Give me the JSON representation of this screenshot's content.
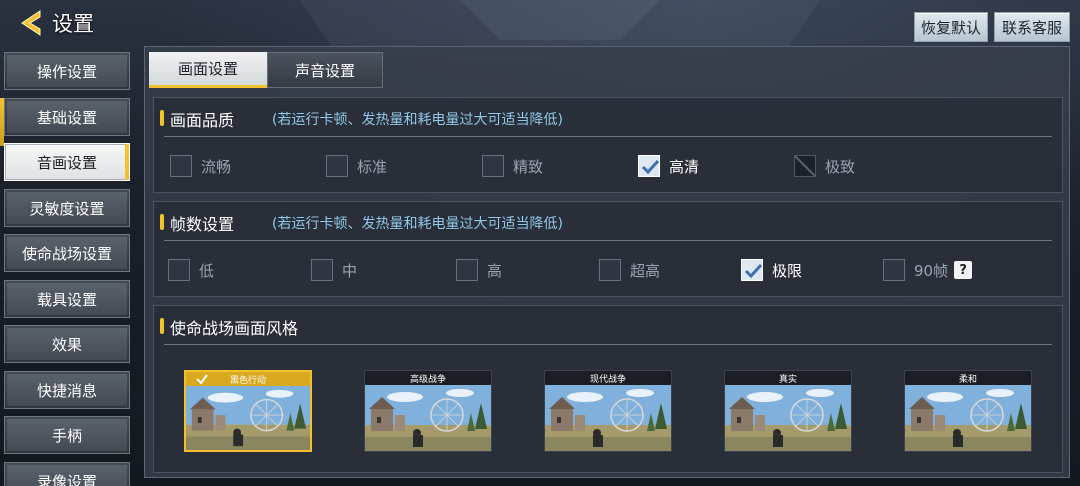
{
  "header": {
    "title": "设置",
    "buttons": {
      "reset": "恢复默认",
      "support": "联系客服"
    }
  },
  "sidebar": {
    "items": [
      {
        "label": "操作设置",
        "active": false
      },
      {
        "label": "基础设置",
        "active": false
      },
      {
        "label": "音画设置",
        "active": true
      },
      {
        "label": "灵敏度设置",
        "active": false
      },
      {
        "label": "使命战场设置",
        "active": false
      },
      {
        "label": "载具设置",
        "active": false
      },
      {
        "label": "效果",
        "active": false
      },
      {
        "label": "快捷消息",
        "active": false
      },
      {
        "label": "手柄",
        "active": false
      },
      {
        "label": "录像设置",
        "active": false
      }
    ]
  },
  "tabs": [
    {
      "label": "画面设置",
      "active": true
    },
    {
      "label": "声音设置",
      "active": false
    }
  ],
  "quality": {
    "title": "画面品质",
    "note": "(若运行卡顿、发热量和耗电量过大可适当降低)",
    "options": [
      {
        "label": "流畅",
        "state": "unchecked"
      },
      {
        "label": "标准",
        "state": "unchecked"
      },
      {
        "label": "精致",
        "state": "unchecked"
      },
      {
        "label": "高清",
        "state": "checked"
      },
      {
        "label": "极致",
        "state": "disabled"
      }
    ]
  },
  "fps": {
    "title": "帧数设置",
    "note": "(若运行卡顿、发热量和耗电量过大可适当降低)",
    "options": [
      {
        "label": "低",
        "state": "unchecked"
      },
      {
        "label": "中",
        "state": "unchecked"
      },
      {
        "label": "高",
        "state": "unchecked"
      },
      {
        "label": "超高",
        "state": "unchecked"
      },
      {
        "label": "极限",
        "state": "checked"
      },
      {
        "label": "90帧",
        "state": "unchecked"
      }
    ],
    "help_icon": "?"
  },
  "style": {
    "title": "使命战场画面风格",
    "cards": [
      {
        "label": "黑色行动",
        "selected": true
      },
      {
        "label": "高级战争",
        "selected": false
      },
      {
        "label": "现代战争",
        "selected": false
      },
      {
        "label": "真实",
        "selected": false
      },
      {
        "label": "柔和",
        "selected": false
      }
    ]
  },
  "colors": {
    "accent": "#f2c12e",
    "note_text": "#8fc8e8",
    "panel": "#373e4a"
  },
  "icons": [
    "back-arrow-icon",
    "checkmark-icon",
    "help-icon"
  ]
}
